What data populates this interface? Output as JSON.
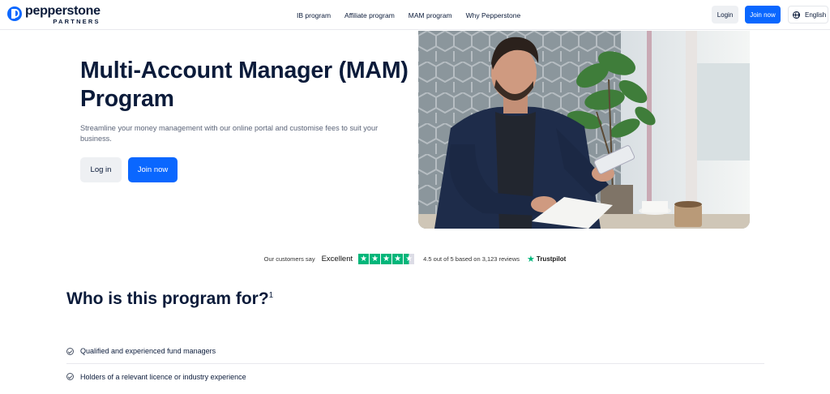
{
  "brand": {
    "name": "pepperstone",
    "sub": "PARTNERS"
  },
  "nav": {
    "items": [
      {
        "label": "IB program"
      },
      {
        "label": "Affiliate program"
      },
      {
        "label": "MAM program"
      },
      {
        "label": "Why Pepperstone"
      }
    ],
    "login_label": "Login",
    "join_label": "Join now",
    "language_label": "English"
  },
  "hero": {
    "title": "Multi-Account Manager (MAM) Program",
    "subtitle": "Streamline your money management with our online portal and customise fees to suit your business.",
    "login_label": "Log in",
    "join_label": "Join now"
  },
  "trustpilot": {
    "customers_say": "Our customers say",
    "rating_word": "Excellent",
    "rating": 4.5,
    "reviews_text": "4.5 out of 5 based on 3,123 reviews",
    "brand": "Trustpilot",
    "star_color": "#00b67a"
  },
  "who": {
    "title": "Who is this program for?",
    "footnote": "1",
    "items": [
      {
        "label": "Qualified and experienced fund managers"
      },
      {
        "label": "Holders of a relevant licence or industry experience"
      }
    ]
  },
  "colors": {
    "accent": "#0a67ff",
    "text": "#0b1b3a"
  }
}
